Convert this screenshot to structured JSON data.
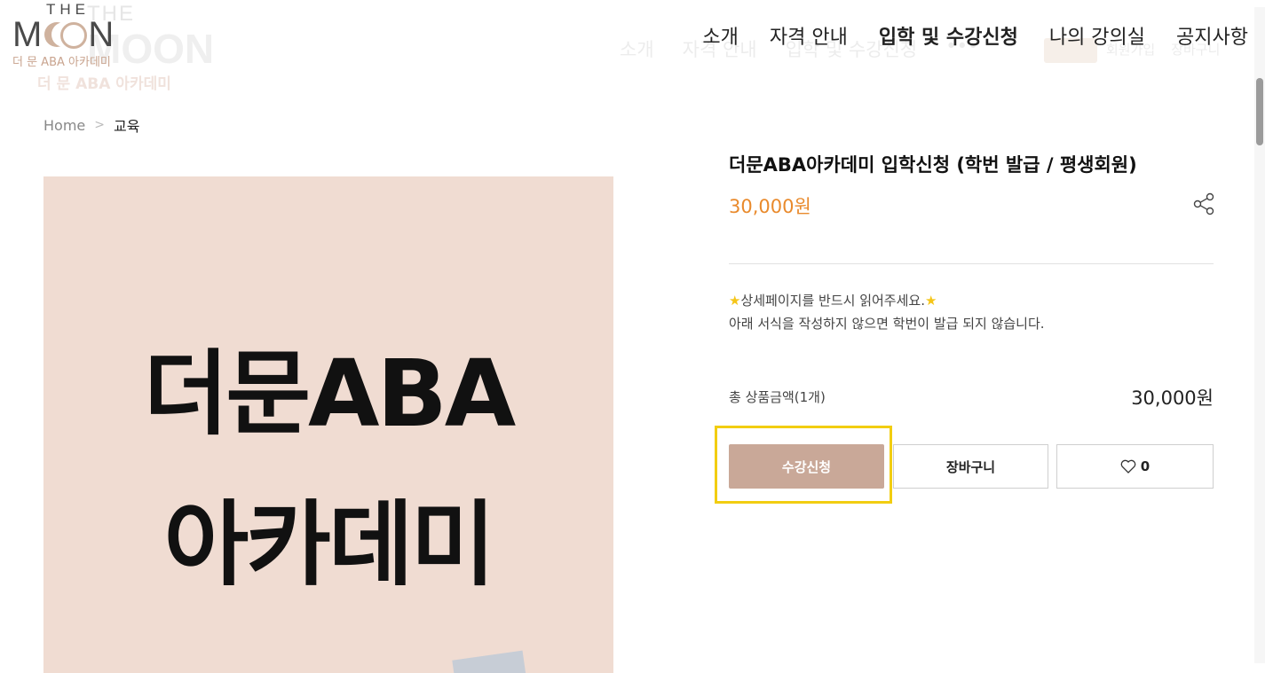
{
  "ghost": {
    "logo_top": "THE",
    "logo_main": "MOON",
    "logo_sub": "더 문 ABA 아카데미",
    "nav": [
      "소개",
      "자격 안내",
      "입학 및 수강신청",
      "•••"
    ],
    "small": [
      "회원가입",
      "장바구니"
    ]
  },
  "logo": {
    "the": "THE",
    "m_left": "M",
    "m_right": "N",
    "subtitle": "더 문 ABA 아카데미"
  },
  "nav": {
    "items": [
      "소개",
      "자격 안내",
      "입학 및 수강신청",
      "나의 강의실",
      "공지사항"
    ],
    "active_index": 2
  },
  "breadcrumb": {
    "home": "Home",
    "separator": ">",
    "current": "교육"
  },
  "product_image": {
    "line1": "더문ABA",
    "line2": "아카데미"
  },
  "product": {
    "title": "더문ABA아카데미 입학신청 (학번 발급 / 평생회원)",
    "price": "30,000원",
    "description_line1": "상세페이지를 반드시 읽어주세요.",
    "description_star": "★",
    "description_line2": "아래 서식을 작성하지 않으면 학번이 발급 되지 않습니다.",
    "total_label": "총 상품금액(1개)",
    "total_price": "30,000원"
  },
  "buttons": {
    "apply": "수강신청",
    "cart": "장바구니",
    "like_count": "0"
  },
  "colors": {
    "price": "#e98a2c",
    "apply_button": "#c9a898",
    "highlight": "#f2cd11",
    "image_bg": "#f0dcd2"
  },
  "icons": [
    "share-icon",
    "heart-icon",
    "chevron-right-icon",
    "star-icon"
  ]
}
